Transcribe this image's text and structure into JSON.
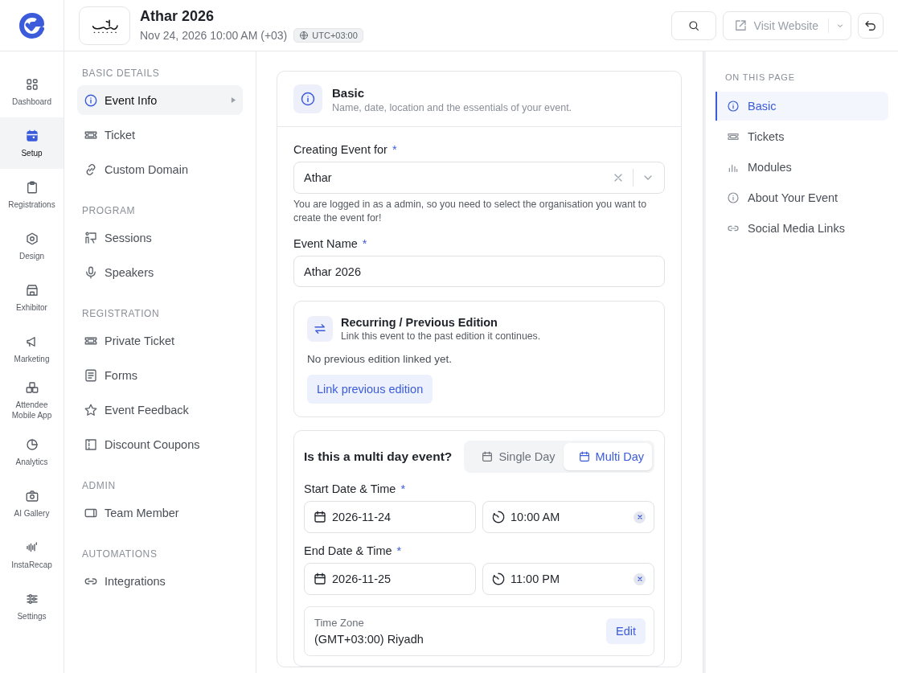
{
  "header": {
    "title": "Athar 2026",
    "subtitle": "Nov 24, 2026 10:00 AM (+03)",
    "timezone_badge": "UTC+03:00",
    "visit_button": "Visit Website"
  },
  "rail": [
    {
      "label": "Dashboard",
      "selected": false
    },
    {
      "label": "Setup",
      "selected": true
    },
    {
      "label": "Registrations",
      "selected": false
    },
    {
      "label": "Design",
      "selected": false
    },
    {
      "label": "Exhibitor",
      "selected": false
    },
    {
      "label": "Marketing",
      "selected": false
    },
    {
      "label": "Attendee Mobile App",
      "selected": false
    },
    {
      "label": "Analytics",
      "selected": false
    },
    {
      "label": "AI Gallery",
      "selected": false
    },
    {
      "label": "InstaRecap",
      "selected": false
    },
    {
      "label": "Settings",
      "selected": false
    }
  ],
  "sidebar": [
    {
      "title": "BASIC DETAILS",
      "items": [
        {
          "label": "Event Info",
          "selected": true
        },
        {
          "label": "Ticket",
          "selected": false
        },
        {
          "label": "Custom Domain",
          "selected": false
        }
      ]
    },
    {
      "title": "PROGRAM",
      "items": [
        {
          "label": "Sessions",
          "selected": false
        },
        {
          "label": "Speakers",
          "selected": false
        }
      ]
    },
    {
      "title": "REGISTRATION",
      "items": [
        {
          "label": "Private Ticket",
          "selected": false
        },
        {
          "label": "Forms",
          "selected": false
        },
        {
          "label": "Event Feedback",
          "selected": false
        },
        {
          "label": "Discount Coupons",
          "selected": false
        }
      ]
    },
    {
      "title": "ADMIN",
      "items": [
        {
          "label": "Team Member",
          "selected": false
        }
      ]
    },
    {
      "title": "AUTOMATIONS",
      "items": [
        {
          "label": "Integrations",
          "selected": false
        }
      ]
    }
  ],
  "section": {
    "title": "Basic",
    "subtitle": "Name, date, location and the essentials of your event."
  },
  "org_field": {
    "label": "Creating Event for",
    "required_mark": "*",
    "value": "Athar",
    "help": "You are logged in as a admin, so you need to select the organisation you want to create the event for!"
  },
  "name_field": {
    "label": "Event Name",
    "required_mark": "*",
    "value": "Athar 2026"
  },
  "recurring": {
    "title": "Recurring / Previous Edition",
    "subtitle": "Link this event to the past edition it continues.",
    "status": "No previous edition linked yet.",
    "button": "Link previous edition"
  },
  "multi_day": {
    "question": "Is this a multi day event?",
    "options": [
      {
        "label": "Single Day",
        "selected": false
      },
      {
        "label": "Multi Day",
        "selected": true
      }
    ]
  },
  "start": {
    "label": "Start Date & Time",
    "required_mark": "*",
    "date": "2026-11-24",
    "time": "10:00 AM"
  },
  "end": {
    "label": "End Date & Time",
    "required_mark": "*",
    "date": "2026-11-25",
    "time": "11:00 PM"
  },
  "timezone": {
    "label": "Time Zone",
    "value": "(GMT+03:00) Riyadh",
    "button": "Edit"
  },
  "on_this_page": {
    "title": "ON THIS PAGE",
    "items": [
      {
        "label": "Basic",
        "selected": true
      },
      {
        "label": "Tickets",
        "selected": false
      },
      {
        "label": "Modules",
        "selected": false
      },
      {
        "label": "About Your Event",
        "selected": false
      },
      {
        "label": "Social Media Links",
        "selected": false
      }
    ]
  }
}
